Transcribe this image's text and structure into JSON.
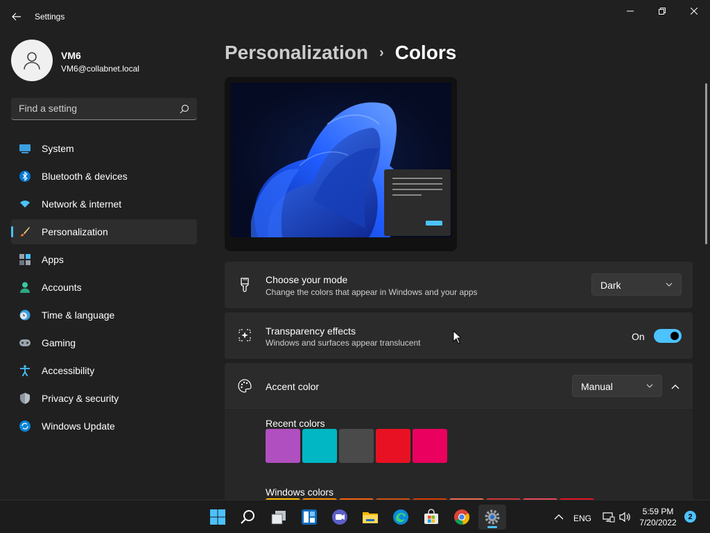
{
  "window": {
    "title": "Settings",
    "controls": {
      "minimize": "minimize",
      "maximize": "restore",
      "close": "close"
    }
  },
  "user": {
    "name": "VM6",
    "email": "VM6@collabnet.local"
  },
  "search": {
    "placeholder": "Find a setting",
    "value": ""
  },
  "sidebar": {
    "items": [
      {
        "label": "System",
        "icon": "monitor-icon",
        "active": false
      },
      {
        "label": "Bluetooth & devices",
        "icon": "bluetooth-icon",
        "active": false
      },
      {
        "label": "Network & internet",
        "icon": "wifi-icon",
        "active": false
      },
      {
        "label": "Personalization",
        "icon": "brush-icon",
        "active": true
      },
      {
        "label": "Apps",
        "icon": "apps-icon",
        "active": false
      },
      {
        "label": "Accounts",
        "icon": "person-icon",
        "active": false
      },
      {
        "label": "Time & language",
        "icon": "clock-globe-icon",
        "active": false
      },
      {
        "label": "Gaming",
        "icon": "gamepad-icon",
        "active": false
      },
      {
        "label": "Accessibility",
        "icon": "accessibility-icon",
        "active": false
      },
      {
        "label": "Privacy & security",
        "icon": "shield-icon",
        "active": false
      },
      {
        "label": "Windows Update",
        "icon": "update-icon",
        "active": false
      }
    ]
  },
  "breadcrumb": {
    "parent": "Personalization",
    "separator": "›",
    "current": "Colors"
  },
  "mode": {
    "title": "Choose your mode",
    "subtitle": "Change the colors that appear in Windows and your apps",
    "value": "Dark"
  },
  "transparency": {
    "title": "Transparency effects",
    "subtitle": "Windows and surfaces appear translucent",
    "state_label": "On",
    "enabled": true
  },
  "accent": {
    "title": "Accent color",
    "value": "Manual",
    "recent_label": "Recent colors",
    "recent_colors": [
      "#b04fbf",
      "#00b7c3",
      "#4a4a4a",
      "#e81123",
      "#ea005e"
    ],
    "windows_label": "Windows colors",
    "windows_colors": [
      "#ffb900",
      "#ff8c00",
      "#f7630c",
      "#ca5010",
      "#da3b01",
      "#ef6950",
      "#d13438",
      "#e74856",
      "#e81123"
    ]
  },
  "taskbar": {
    "apps": [
      "windows-start-icon",
      "search-icon",
      "task-view-icon",
      "widgets-icon",
      "teams-chat-icon",
      "file-explorer-icon",
      "edge-icon",
      "store-icon",
      "chrome-icon",
      "settings-icon"
    ],
    "active_app": "settings-icon",
    "language": "ENG",
    "time": "5:59 PM",
    "date": "7/20/2022",
    "notification_count": "2"
  },
  "colors": {
    "accent": "#4cc2ff",
    "background": "#202020",
    "card": "#2b2b2b"
  }
}
